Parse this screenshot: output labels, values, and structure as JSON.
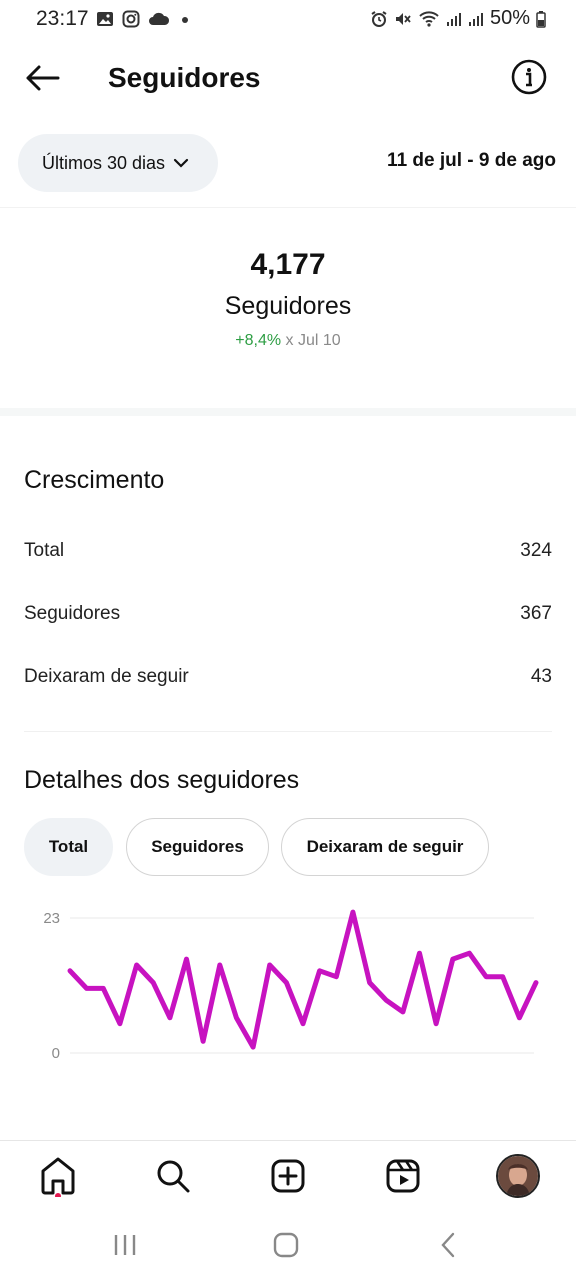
{
  "status_bar": {
    "time": "23:17",
    "battery": "50%",
    "left_icons": [
      "image-icon",
      "instagram-icon",
      "cloud-icon",
      "dot-icon"
    ],
    "right_icons": [
      "alarm-icon",
      "mute-icon",
      "wifi-icon",
      "signal-icon",
      "signal-icon",
      "battery-icon"
    ]
  },
  "header": {
    "title": "Seguidores"
  },
  "range": {
    "selector_label": "Últimos 30 dias",
    "date_range": "11 de jul - 9 de ago"
  },
  "summary": {
    "count": "4,177",
    "label": "Seguidores",
    "delta": "+8,4%",
    "delta_suffix": " x Jul 10"
  },
  "growth": {
    "title": "Crescimento",
    "rows": [
      {
        "label": "Total",
        "value": "324"
      },
      {
        "label": "Seguidores",
        "value": "367"
      },
      {
        "label": "Deixaram de seguir",
        "value": "43"
      }
    ]
  },
  "details": {
    "title": "Detalhes dos seguidores",
    "tabs": [
      "Total",
      "Seguidores",
      "Deixaram de seguir"
    ],
    "active_tab": "Total"
  },
  "chart_data": {
    "type": "line",
    "series": [
      {
        "values": [
          14,
          11,
          11,
          5,
          15,
          12,
          6,
          16,
          2,
          15,
          6,
          1,
          15,
          12,
          5,
          14,
          13,
          24,
          12,
          9,
          7,
          17,
          5,
          16,
          17,
          13,
          13,
          6,
          12
        ]
      }
    ],
    "ylim": [
      0,
      23
    ],
    "yticks": [
      "23",
      "0"
    ],
    "xlabel": "",
    "ylabel": "",
    "grid": true,
    "line_color": "#c713c0"
  },
  "bottom_nav": {
    "items": [
      "home-icon",
      "search-icon",
      "create-icon",
      "reels-icon",
      "profile-avatar"
    ],
    "active": "home-icon",
    "notification_dot_color": "#e2174f"
  },
  "system_nav": {
    "items": [
      "recents-icon",
      "home-button-icon",
      "back-icon"
    ]
  },
  "colors": {
    "accent_positive": "#2e9e44",
    "pill_background": "#eff2f5"
  }
}
